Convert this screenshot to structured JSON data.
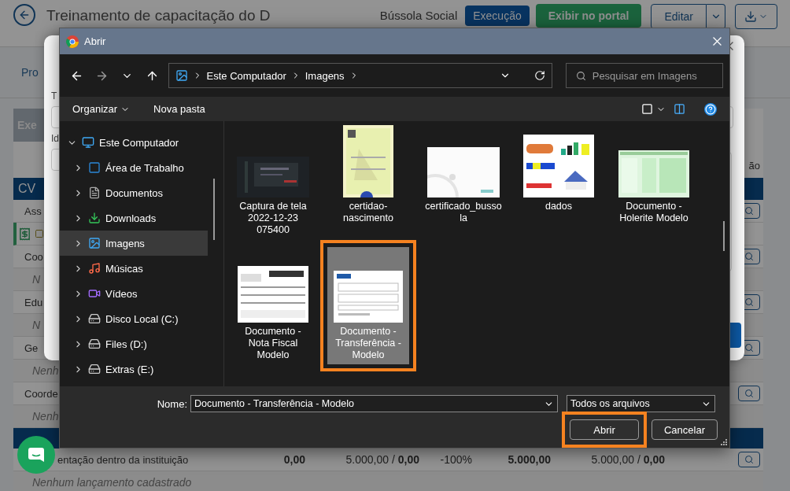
{
  "background": {
    "title": "Treinamento de capacitação do D",
    "program": "Bússola Social",
    "status_badge": "Execução",
    "portal_button": "Exibir no portal",
    "edit_button": "Editar",
    "section_tab": "Pro",
    "card_tab": "Exe",
    "column_label": "ão",
    "table_header": "CV",
    "rows": [
      {
        "kind": "item",
        "label": "Ass"
      },
      {
        "kind": "attachment"
      },
      {
        "kind": "item",
        "label": "Coo"
      },
      {
        "kind": "empty",
        "label": "N"
      },
      {
        "kind": "item",
        "label": "Edu"
      },
      {
        "kind": "empty",
        "label": "N"
      },
      {
        "kind": "item",
        "label": "Ge"
      },
      {
        "kind": "empty",
        "label": "Nenh"
      },
      {
        "kind": "item",
        "label": "Coorde"
      },
      {
        "kind": "empty",
        "label": "Nenh"
      },
      {
        "kind": "section"
      },
      {
        "kind": "values",
        "label": "entação dentro da instituição",
        "cells": [
          {
            "text": "0,00",
            "bold": true
          },
          {
            "text": "5.000,00 / **0,00**",
            "bold": false
          },
          {
            "text": "-100%",
            "bold": false
          },
          {
            "text": "5.000,00",
            "bold": true
          },
          {
            "text": "5.000,00 / **0,00**",
            "bold": false
          }
        ]
      },
      {
        "kind": "empty",
        "label": "Nenhum lançamento cadastrado"
      }
    ]
  },
  "modal": {
    "labels": [
      "T",
      "Id"
    ]
  },
  "dialog": {
    "title": "Abrir",
    "path": [
      "Este Computador",
      "Imagens"
    ],
    "search_placeholder": "Pesquisar em Imagens",
    "commands": [
      {
        "label": "Organizar",
        "menu": true
      },
      {
        "label": "Nova pasta",
        "menu": false
      }
    ],
    "tree": [
      {
        "label": "Este Computador",
        "kind": "computer",
        "expanded": true,
        "selected": false,
        "children": [
          {
            "label": "Área de Trabalho",
            "kind": "desktop",
            "expanded": false,
            "selected": false
          },
          {
            "label": "Documentos",
            "kind": "documents",
            "expanded": false,
            "selected": false
          },
          {
            "label": "Downloads",
            "kind": "downloads",
            "expanded": false,
            "selected": false
          },
          {
            "label": "Imagens",
            "kind": "pictures",
            "expanded": false,
            "selected": true
          },
          {
            "label": "Músicas",
            "kind": "music",
            "expanded": false,
            "selected": false
          },
          {
            "label": "Vídeos",
            "kind": "videos",
            "expanded": false,
            "selected": false
          },
          {
            "label": "Disco Local (C:)",
            "kind": "drive",
            "expanded": false,
            "selected": false
          },
          {
            "label": "Files (D:)",
            "kind": "drive",
            "expanded": false,
            "selected": false
          },
          {
            "label": "Extras (E:)",
            "kind": "drive",
            "expanded": false,
            "selected": false
          }
        ]
      }
    ],
    "files": [
      {
        "name": "Captura de tela 2022-12-23 075400",
        "kind": "picture",
        "selected": false,
        "highlighted": false
      },
      {
        "name": "certidao-nascimento",
        "kind": "picture",
        "selected": false,
        "highlighted": false
      },
      {
        "name": "certificado_bussola",
        "kind": "picture",
        "selected": false,
        "highlighted": false
      },
      {
        "name": "dados",
        "kind": "picture",
        "selected": false,
        "highlighted": false
      },
      {
        "name": "Documento - Holerite Modelo",
        "kind": "picture",
        "selected": false,
        "highlighted": false
      },
      {
        "name": "Documento - Nota Fiscal Modelo",
        "kind": "picture",
        "selected": false,
        "highlighted": false
      },
      {
        "name": "Documento - Transferência - Modelo",
        "kind": "picture",
        "selected": true,
        "highlighted": true
      }
    ],
    "name_label": "Nome:",
    "filename": "Documento - Transferência - Modelo",
    "filetype": "Todos os arquivos",
    "buttons": [
      {
        "label": "Abrir",
        "highlighted": true
      },
      {
        "label": "Cancelar",
        "highlighted": false
      }
    ]
  }
}
